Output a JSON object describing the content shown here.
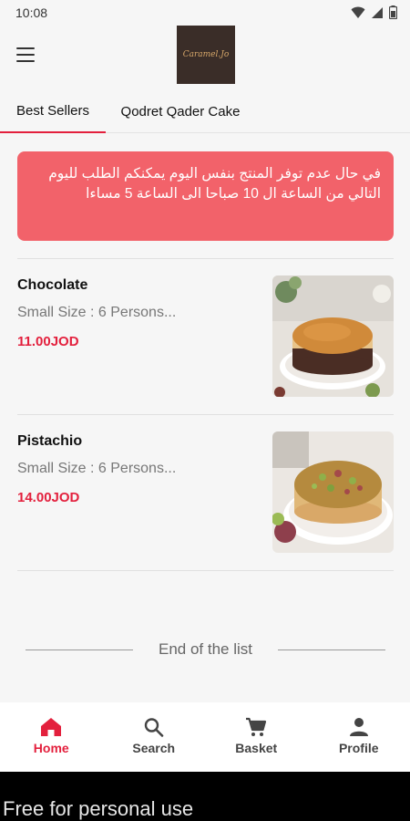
{
  "status_bar": {
    "time": "10:08"
  },
  "header": {
    "logo_text": "Caramel.Jo"
  },
  "tabs": [
    {
      "label": "Best Sellers",
      "active": true
    },
    {
      "label": "Qodret Qader Cake",
      "active": false
    }
  ],
  "notice": {
    "text": "في حال عدم توفر المنتج بنفس اليوم يمكنكم الطلب لليوم التالي من الساعة ال 10 صباحا الى الساعة 5 مساءا"
  },
  "products": [
    {
      "name": "Chocolate",
      "description": "Small Size : 6 Persons...",
      "price": "11.00JOD",
      "image": "cheesecake-image"
    },
    {
      "name": "Pistachio",
      "description": "Small Size : 6 Persons...",
      "price": "14.00JOD",
      "image": "pistachio-cake-image"
    }
  ],
  "end_of_list": "End of the list",
  "bottom_nav": [
    {
      "label": "Home",
      "icon": "home-icon",
      "active": true
    },
    {
      "label": "Search",
      "icon": "search-icon",
      "active": false
    },
    {
      "label": "Basket",
      "icon": "cart-icon",
      "active": false
    },
    {
      "label": "Profile",
      "icon": "person-icon",
      "active": false
    }
  ],
  "watermark": "Free for personal use",
  "colors": {
    "accent": "#e3203d",
    "notice_bg": "#f2626a"
  }
}
